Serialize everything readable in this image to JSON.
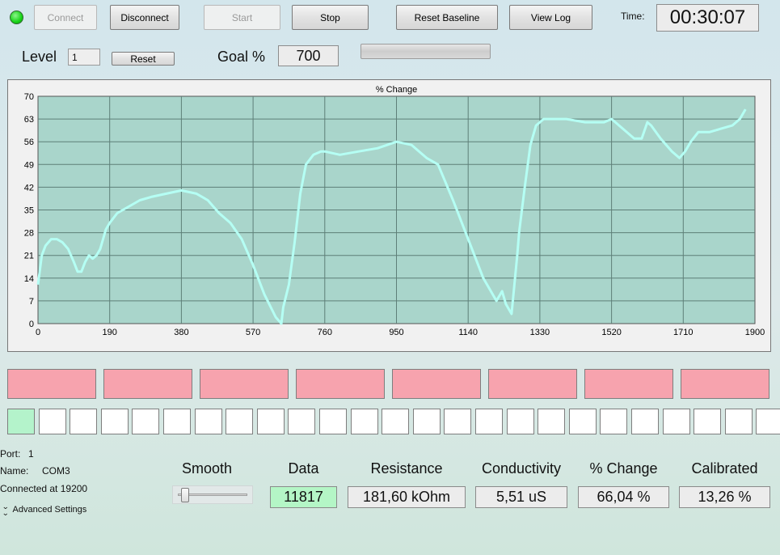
{
  "status": {
    "indicator_color": "#16d316"
  },
  "toolbar": {
    "connect": "Connect",
    "disconnect": "Disconnect",
    "start": "Start",
    "stop": "Stop",
    "reset_baseline": "Reset Baseline",
    "view_log": "View Log",
    "time_label": "Time:",
    "time_value": "00:30:07"
  },
  "level": {
    "label": "Level",
    "value": "1",
    "reset": "Reset"
  },
  "goal": {
    "label": "Goal %",
    "value": "700",
    "progress": 0
  },
  "chart_data": {
    "type": "line",
    "title": "% Change",
    "xlabel": "",
    "ylabel": "",
    "xlim": [
      0,
      1900
    ],
    "ylim": [
      0,
      70
    ],
    "xticks": [
      0,
      190,
      380,
      570,
      760,
      950,
      1140,
      1330,
      1520,
      1710,
      1900
    ],
    "yticks": [
      0,
      7,
      14,
      21,
      28,
      35,
      42,
      49,
      56,
      63,
      70
    ],
    "grid": true,
    "line_color": "#b5fff4",
    "plot_bg": "#a9d5cb",
    "series": [
      {
        "x": [
          0,
          10,
          20,
          35,
          50,
          65,
          80,
          95,
          105,
          115,
          125,
          135,
          145,
          155,
          165,
          180,
          190,
          210,
          240,
          270,
          300,
          340,
          380,
          420,
          450,
          480,
          510,
          540,
          570,
          600,
          630,
          645,
          650,
          665,
          680,
          695,
          710,
          730,
          750,
          760,
          800,
          850,
          900,
          950,
          990,
          1030,
          1060,
          1100,
          1140,
          1180,
          1215,
          1230,
          1240,
          1255,
          1270,
          1275,
          1290,
          1305,
          1320,
          1340,
          1360,
          1400,
          1450,
          1500,
          1520,
          1550,
          1580,
          1600,
          1615,
          1625,
          1650,
          1680,
          1700,
          1715,
          1730,
          1750,
          1780,
          1810,
          1840,
          1860,
          1875
        ],
        "y": [
          12,
          21,
          24,
          26,
          26,
          25,
          23,
          19,
          16,
          16,
          19,
          21,
          20,
          21,
          23,
          29,
          31,
          34,
          36,
          38,
          39,
          40,
          41,
          40,
          38,
          34,
          31,
          26,
          18,
          9,
          2,
          0,
          5,
          12,
          25,
          40,
          49,
          52,
          53,
          53,
          52,
          53,
          54,
          56,
          55,
          51,
          49,
          38,
          26,
          14,
          7,
          10,
          6,
          3,
          21,
          28,
          42,
          55,
          61,
          63,
          63,
          63,
          62,
          62,
          63,
          60,
          57,
          57,
          62,
          61,
          57,
          53,
          51,
          53,
          56,
          59,
          59,
          60,
          61,
          63,
          66
        ]
      }
    ]
  },
  "indicators": {
    "pink_count": 8,
    "cells": [
      true,
      false,
      false,
      false,
      false,
      false,
      false,
      false,
      false,
      false,
      false,
      false,
      false,
      false,
      false,
      false,
      false,
      false,
      false,
      false,
      false,
      false,
      false,
      false,
      false
    ]
  },
  "port": {
    "port_label": "Port:",
    "port_value": "1",
    "name_label": "Name:",
    "name_value": "COM3",
    "connected": "Connected at 19200",
    "advanced": "Advanced Settings"
  },
  "smooth": {
    "label": "Smooth",
    "level": 0.1
  },
  "readouts": {
    "data_label": "Data",
    "data_value": "11817",
    "resistance_label": "Resistance",
    "resistance_value": "181,60 kOhm",
    "conductivity_label": "Conductivity",
    "conductivity_value": "5,51 uS",
    "change_label": "% Change",
    "change_value": "66,04 %",
    "calibrated_label": "Calibrated",
    "calibrated_value": "13,26 %"
  }
}
